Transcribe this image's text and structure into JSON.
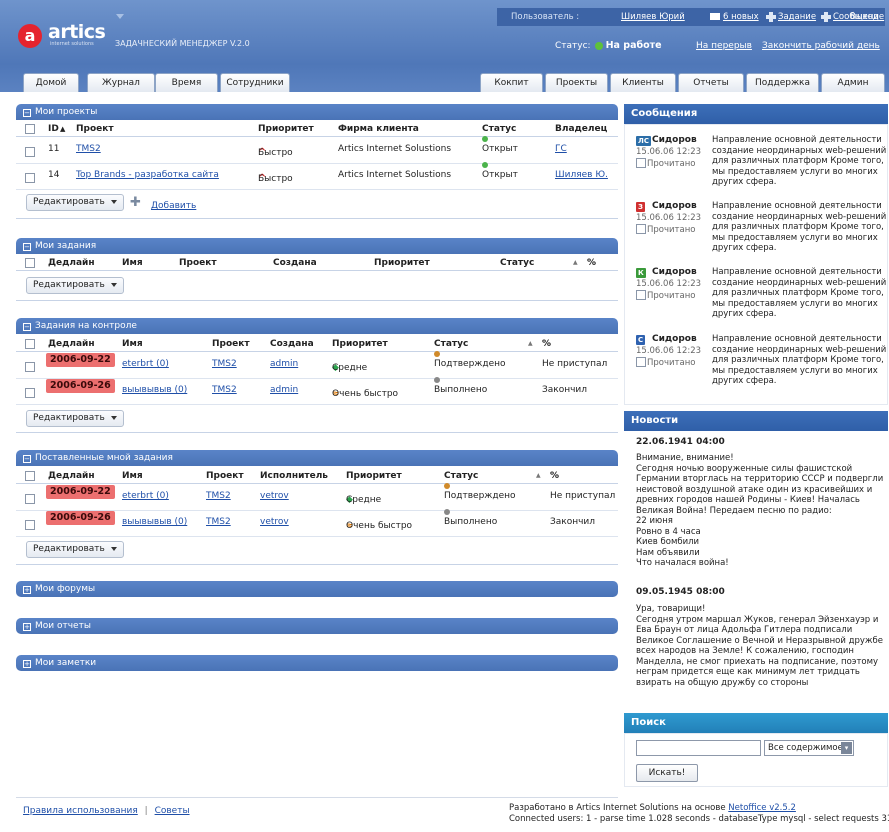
{
  "app": {
    "logo_text": "artics",
    "logo_letter": "a",
    "logo_sub": "internet solutions",
    "title": "ЗАДАЧНЕСКИЙ МЕНЕДЖЕР V.2.0"
  },
  "topbar": {
    "user_label": "Пользователь :",
    "user_name": "Шиляев Юрий",
    "new_count": "6 новых",
    "task": "Задание",
    "message": "Сообщение",
    "logout": "Выход"
  },
  "status": {
    "label": "Статус:",
    "value": "На работе",
    "break": "На перерыв",
    "end_day": "Закончить рабочий день"
  },
  "tabs_left": [
    "Домой",
    "Журнал",
    "Время",
    "Сотрудники"
  ],
  "tabs_right": [
    "Кокпит",
    "Проекты",
    "Клиенты",
    "Отчеты",
    "Поддержка",
    "Админ"
  ],
  "projects": {
    "title": "Мои проекты",
    "columns": [
      "ID",
      "Проект",
      "Приоритет",
      "Фирма клиента",
      "Статус",
      "Владелец"
    ],
    "rows": [
      {
        "id": "11",
        "name": "TMS2",
        "priority": "Быстро",
        "client": "Artics Internet Solustions",
        "status": "Открыт",
        "owner": "ГС"
      },
      {
        "id": "14",
        "name": "Top Brands - разработка сайта",
        "priority": "Быстро",
        "client": "Artics Internet Solustions",
        "status": "Открыт",
        "owner": "Шиляев Ю."
      }
    ],
    "edit": "Редактировать",
    "add": "Добавить"
  },
  "tasks": {
    "title": "Мои задания",
    "columns": [
      "Дедлайн",
      "Имя",
      "Проект",
      "Создана",
      "Приоритет",
      "Статус",
      "%"
    ],
    "edit": "Редактировать"
  },
  "controlled": {
    "title": "Задания на контроле",
    "columns": [
      "Дедлайн",
      "Имя",
      "Проект",
      "Создана",
      "Приоритет",
      "Статус",
      "%"
    ],
    "rows": [
      {
        "deadline": "2006-09-22",
        "name": "eterbrt (0)",
        "project": "TMS2",
        "created": "admin",
        "priority": "Средне",
        "status": "Подтверждено",
        "percent": "Не приступал"
      },
      {
        "deadline": "2006-09-26",
        "name": "выывывыв (0)",
        "project": "TMS2",
        "created": "admin",
        "priority": "Очень быстро",
        "status": "Выполнено",
        "percent": "Закончил"
      }
    ],
    "edit": "Редактировать"
  },
  "assigned": {
    "title": "Поставленные мной задания",
    "columns": [
      "Дедлайн",
      "Имя",
      "Проект",
      "Исполнитель",
      "Приоритет",
      "Статус",
      "%"
    ],
    "rows": [
      {
        "deadline": "2006-09-22",
        "name": "eterbrt (0)",
        "project": "TMS2",
        "assignee": "vetrov",
        "priority": "Средне",
        "status": "Подтверждено",
        "percent": "Не приступал"
      },
      {
        "deadline": "2006-09-26",
        "name": "выывывыв (0)",
        "project": "TMS2",
        "assignee": "vetrov",
        "priority": "Очень быстро",
        "status": "Выполнено",
        "percent": "Закончил"
      }
    ],
    "edit": "Редактировать"
  },
  "collapsed": [
    "Мои форумы",
    "Мои отчеты",
    "Мои заметки"
  ],
  "messages": {
    "title": "Сообщения",
    "read_label": "Прочитано",
    "items": [
      {
        "badge": "ЛС",
        "badge_color": "#2c6ea8",
        "author": "Сидоров",
        "date": "15.06.06 12:23",
        "text": "Направление основной деятельности создание неординарных web-решений для различных платформ Кроме того, мы предоставляем услуги во многих других сфера."
      },
      {
        "badge": "З",
        "badge_color": "#d03030",
        "author": "Сидоров",
        "date": "15.06.06 12:23",
        "text": "Направление основной деятельности создание неординарных web-решений для различных платформ Кроме того, мы предоставляем услуги во многих других сфера."
      },
      {
        "badge": "К",
        "badge_color": "#3a9a3a",
        "author": "Сидоров",
        "date": "15.06.06 12:23",
        "text": "Направление основной деятельности создание неординарных web-решений для различных платформ Кроме того, мы предоставляем услуги во многих других сфера."
      },
      {
        "badge": "С",
        "badge_color": "#2f62b0",
        "author": "Сидоров",
        "date": "15.06.06 12:23",
        "text": "Направление основной деятельности создание неординарных web-решений для различных платформ Кроме того, мы предоставляем услуги во многих других сфера."
      }
    ]
  },
  "news": {
    "title": "Новости",
    "items": [
      {
        "date": "22.06.1941 04:00",
        "text": "Внимание, внимание!\nСегодня ночью вооруженные силы фашистской Германии вторглась на территорию СССР и подвергли неистовой воздушной атаке один из красивейших и древних городов нашей Родины - Киев! Началась Великая Война! Передаем песню по радио:\n22 июня\nРовно в 4 часа\nКиев бомбили\nНам объявили\nЧто началася война!"
      },
      {
        "date": "09.05.1945 08:00",
        "text": "Ура, товарищи!\nСегодня утром маршал Жуков, генерал Эйзенхауэр и Ева Браун от лица Адольфа Гитлера подписали Великое Соглашение о Вечной и Неразрывной дружбе всех народов на Земле! К сожалению, господин Манделла, не смог приехать на подписание, поэтому неграм придется еще как минимум лет тридцать взирать на общую дружбу со стороны"
      }
    ]
  },
  "search": {
    "title": "Поиск",
    "input_value": "",
    "select_value": "Все содержимое",
    "button": "Искать!"
  },
  "footer": {
    "rules": "Правила использования",
    "tips": "Советы",
    "dev_prefix": "Разработано в Artics Internet Solutions на основе",
    "dev_link": "Netoffice v2.5.2",
    "stats": "Connected users: 1 - parse time 1.028 seconds - databaseType mysql - select requests 3179"
  }
}
